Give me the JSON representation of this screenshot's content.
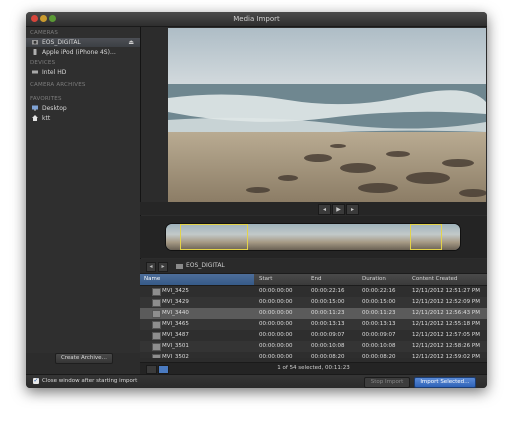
{
  "window": {
    "title": "Media Import"
  },
  "sidebar": {
    "sections": [
      {
        "header": "CAMERAS",
        "items": [
          {
            "label": "EOS_DIGITAL",
            "selected": true,
            "icon": "camera-icon",
            "eject": "⏏"
          },
          {
            "label": "Apple iPod (iPhone 4S)…",
            "selected": false,
            "icon": "phone-icon"
          }
        ]
      },
      {
        "header": "DEVICES",
        "items": [
          {
            "label": "Intel HD",
            "selected": false,
            "icon": "drive-icon"
          }
        ]
      },
      {
        "header": "CAMERA ARCHIVES",
        "items": []
      },
      {
        "header": "FAVORITES",
        "items": [
          {
            "label": "Desktop",
            "selected": false,
            "icon": "desktop-icon"
          },
          {
            "label": "ktt",
            "selected": false,
            "icon": "home-icon"
          }
        ]
      }
    ],
    "create_archive_label": "Create Archive…"
  },
  "list": {
    "breadcrumb": "EOS_DIGITAL",
    "columns": [
      "Name",
      "Start",
      "End",
      "Duration",
      "Content Created"
    ],
    "rows": [
      {
        "name": "MVI_3425",
        "start": "00:00:00:00",
        "end": "00:00:22:16",
        "duration": "00:00:22:16",
        "created": "12/11/2012 12:51:27 PM",
        "selected": false
      },
      {
        "name": "MVI_3429",
        "start": "00:00:00:00",
        "end": "00:00:15:00",
        "duration": "00:00:15:00",
        "created": "12/11/2012 12:52:09 PM",
        "selected": false
      },
      {
        "name": "MVI_3440",
        "start": "00:00:00:00",
        "end": "00:00:11:23",
        "duration": "00:00:11:23",
        "created": "12/11/2012 12:56:43 PM",
        "selected": true
      },
      {
        "name": "MVI_3465",
        "start": "00:00:00:00",
        "end": "00:00:13:13",
        "duration": "00:00:13:13",
        "created": "12/11/2012 12:55:18 PM",
        "selected": false
      },
      {
        "name": "MVI_3487",
        "start": "00:00:00:00",
        "end": "00:00:09:07",
        "duration": "00:00:09:07",
        "created": "12/11/2012 12:57:05 PM",
        "selected": false
      },
      {
        "name": "MVI_3501",
        "start": "00:00:00:00",
        "end": "00:00:10:08",
        "duration": "00:00:10:08",
        "created": "12/11/2012 12:58:26 PM",
        "selected": false
      },
      {
        "name": "MVI_3502",
        "start": "00:00:00:00",
        "end": "00:00:08:20",
        "duration": "00:00:08:20",
        "created": "12/11/2012 12:59:02 PM",
        "selected": false
      }
    ]
  },
  "status": {
    "text": "1 of 54 selected, 00:11:23"
  },
  "footer": {
    "checkbox_checked": true,
    "checkbox_label": "Close window after starting import",
    "stop_import_label": "Stop Import",
    "import_selected_label": "Import Selected…"
  },
  "colors": {
    "accent": "#3b6fc4",
    "selection_range": "#e3d34a"
  }
}
